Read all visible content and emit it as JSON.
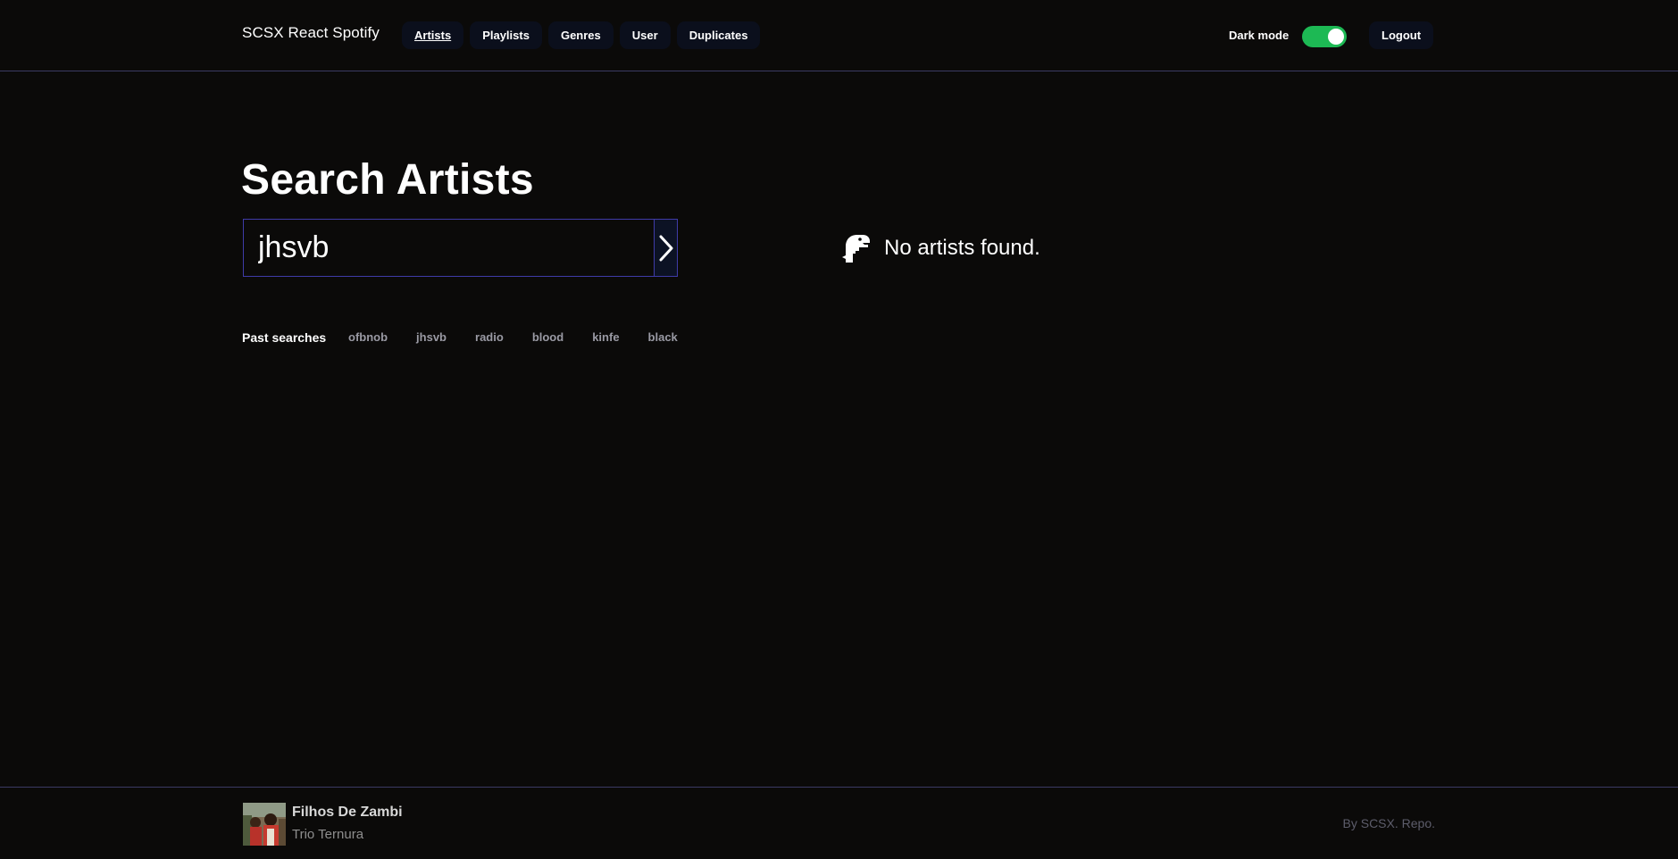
{
  "header": {
    "brand": "SCSX React Spotify",
    "nav": [
      {
        "label": "Artists",
        "active": true
      },
      {
        "label": "Playlists",
        "active": false
      },
      {
        "label": "Genres",
        "active": false
      },
      {
        "label": "User",
        "active": false
      },
      {
        "label": "Duplicates",
        "active": false
      }
    ],
    "dark_mode_label": "Dark mode",
    "dark_mode_on": true,
    "logout_label": "Logout"
  },
  "main": {
    "title": "Search Artists",
    "search": {
      "value": "jhsvb",
      "submit_icon": "chevron-right-icon"
    },
    "past_searches_label": "Past searches",
    "past_searches": [
      "ofbnob",
      "jhsvb",
      "radio",
      "blood",
      "kinfe",
      "black"
    ],
    "empty_state": {
      "icon": "dinosaur-icon",
      "message": "No artists found."
    }
  },
  "player": {
    "track_title": "Filhos De Zambi",
    "track_artist": "Trio Ternura",
    "album_art_icon": "album-art-image"
  },
  "footer": {
    "credit_prefix": "By SCSX.",
    "repo_label": "Repo."
  },
  "colors": {
    "background": "#0b0a09",
    "nav_button_bg": "#0b0f1c",
    "accent_border": "#3f3ba8",
    "toggle_on": "#1db954",
    "divider": "#3b3b63"
  }
}
